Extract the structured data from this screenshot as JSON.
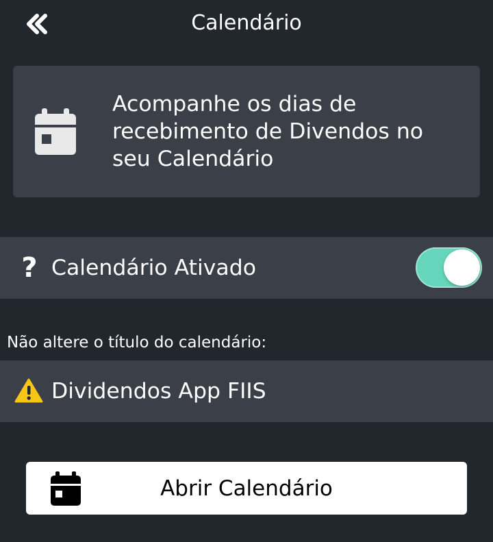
{
  "header": {
    "title": "Calendário",
    "back_icon": "double-chevron-left-icon"
  },
  "info_card": {
    "icon": "calendar-icon",
    "text": "Acompanhe os dias de recebimento de Divendos no seu Calendário"
  },
  "toggle_row": {
    "help_icon": "question-icon",
    "help_glyph": "?",
    "label": "Calendário Ativado",
    "enabled": true
  },
  "section_label": "Não altere o título do calendário:",
  "calendar_name_row": {
    "icon": "warning-icon",
    "value": "Dividendos App FIIS"
  },
  "open_button": {
    "icon": "calendar-icon",
    "label": "Abrir Calendário"
  },
  "colors": {
    "background": "#22262d",
    "card": "#3b3f47",
    "toggle_on": "#65d6bb",
    "warning": "#f5c518",
    "button_bg": "#ffffff"
  }
}
